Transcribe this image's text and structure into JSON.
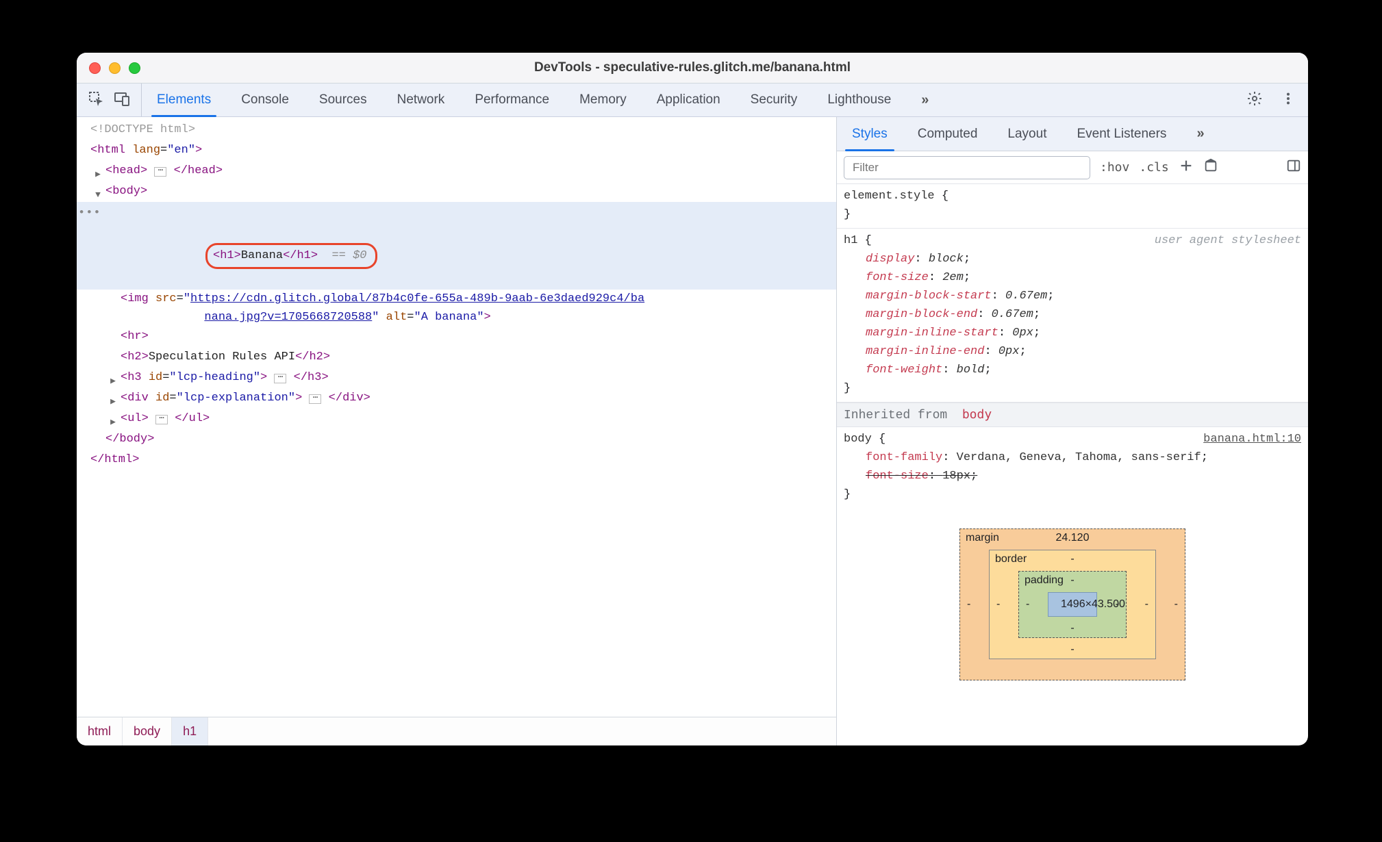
{
  "window_title": "DevTools - speculative-rules.glitch.me/banana.html",
  "main_tabs": [
    "Elements",
    "Console",
    "Sources",
    "Network",
    "Performance",
    "Memory",
    "Application",
    "Security",
    "Lighthouse"
  ],
  "main_active": "Elements",
  "dom": {
    "doctype": "<!DOCTYPE html>",
    "html_open": "<html lang=\"en\">",
    "head_open": "<head>",
    "head_close": "</head>",
    "body_open": "<body>",
    "selected_h1_open": "<h1>",
    "selected_h1_text": "Banana",
    "selected_h1_close": "</h1>",
    "selected_suffix": " == $0",
    "img_src_p1": "https://cdn.glitch.global/87b4c0fe-655a-489b-9aab-6e3daed929c4/ba",
    "img_src_p2": "nana.jpg?v=1705668720588",
    "img_alt": "A banana",
    "hr": "<hr>",
    "h2_text": "Speculation Rules API",
    "h3_id": "lcp-heading",
    "div_id": "lcp-explanation",
    "body_close": "</body>",
    "html_close": "</html>"
  },
  "breadcrumbs": [
    "html",
    "body",
    "h1"
  ],
  "styles_tabs": [
    "Styles",
    "Computed",
    "Layout",
    "Event Listeners"
  ],
  "styles_active": "Styles",
  "filter_placeholder": "Filter",
  "toggles": {
    "hov": ":hov",
    "cls": ".cls"
  },
  "css": {
    "element_style_selector": "element.style",
    "h1": {
      "selector": "h1",
      "note": "user agent stylesheet",
      "props": [
        {
          "p": "display",
          "v": "block"
        },
        {
          "p": "font-size",
          "v": "2em"
        },
        {
          "p": "margin-block-start",
          "v": "0.67em"
        },
        {
          "p": "margin-block-end",
          "v": "0.67em"
        },
        {
          "p": "margin-inline-start",
          "v": "0px"
        },
        {
          "p": "margin-inline-end",
          "v": "0px"
        },
        {
          "p": "font-weight",
          "v": "bold"
        }
      ]
    },
    "inherited_label": "Inherited from",
    "inherited_from": "body",
    "body_rule": {
      "selector": "body",
      "source": "banana.html:10",
      "props": [
        {
          "p": "font-family",
          "v": "Verdana, Geneva, Tahoma, sans-serif",
          "strike": false
        },
        {
          "p": "font-size",
          "v": "18px",
          "strike": true
        }
      ]
    }
  },
  "box_model": {
    "margin_label": "margin",
    "margin_top": "24.120",
    "border_label": "border",
    "padding_label": "padding",
    "content": "1496×43.500",
    "dash": "-"
  }
}
